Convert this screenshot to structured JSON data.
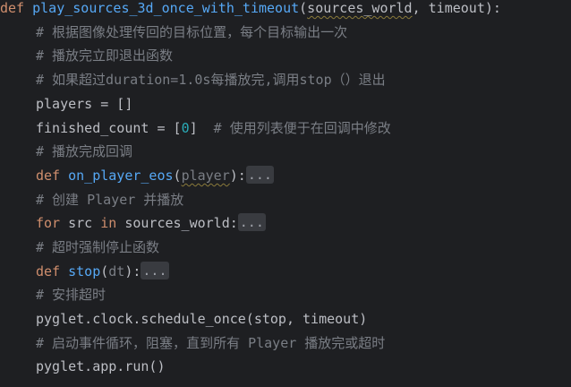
{
  "code": {
    "l1": {
      "kw": "def",
      "fn": "play_sources_3d_once_with_timeout",
      "open": "(",
      "p1": "sources_world",
      "sep": ", ",
      "p2": "timeout",
      "close": "):"
    },
    "l2": {
      "comment": "# 根据图像处理传回的目标位置，每个目标输出一次"
    },
    "l3": {
      "comment": "# 播放完立即退出函数"
    },
    "l4": {
      "comment": "# 如果超过duration=1.0s每播放完,调用stop（）退出"
    },
    "l5": {
      "text": "players = []"
    },
    "l6": {
      "a": "finished_count = [",
      "num": "0",
      "b": "]",
      "comment": "  # 使用列表便于在回调中修改"
    },
    "l7": {
      "comment": "# 播放完成回调"
    },
    "l8": {
      "kw": "def",
      "fn": "on_player_eos",
      "open": "(",
      "param": "player",
      "close": "):",
      "fold": "..."
    },
    "l9": {
      "comment": "# 创建 Player 并播放"
    },
    "l10": {
      "kw1": "for",
      "a": " src ",
      "kw2": "in",
      "b": " sources_world:",
      "fold": "..."
    },
    "l11": {
      "comment": "# 超时强制停止函数"
    },
    "l12": {
      "kw": "def",
      "fn": "stop",
      "open": "(",
      "param": "dt",
      "close": "):",
      "fold": "..."
    },
    "l13": {
      "comment": "# 安排超时"
    },
    "l14": {
      "text": "pyglet.clock.schedule_once(stop, timeout)"
    },
    "l15": {
      "comment": "# 启动事件循环，阻塞，直到所有 Player 播放完或超时"
    },
    "l16": {
      "text": "pyglet.app.run()"
    }
  },
  "colors": {
    "background": "#1e1f22",
    "keyword": "#cf8e6d",
    "function": "#56a8f5",
    "comment": "#7a7e85",
    "number": "#2aacb8",
    "text": "#bcbec4"
  }
}
